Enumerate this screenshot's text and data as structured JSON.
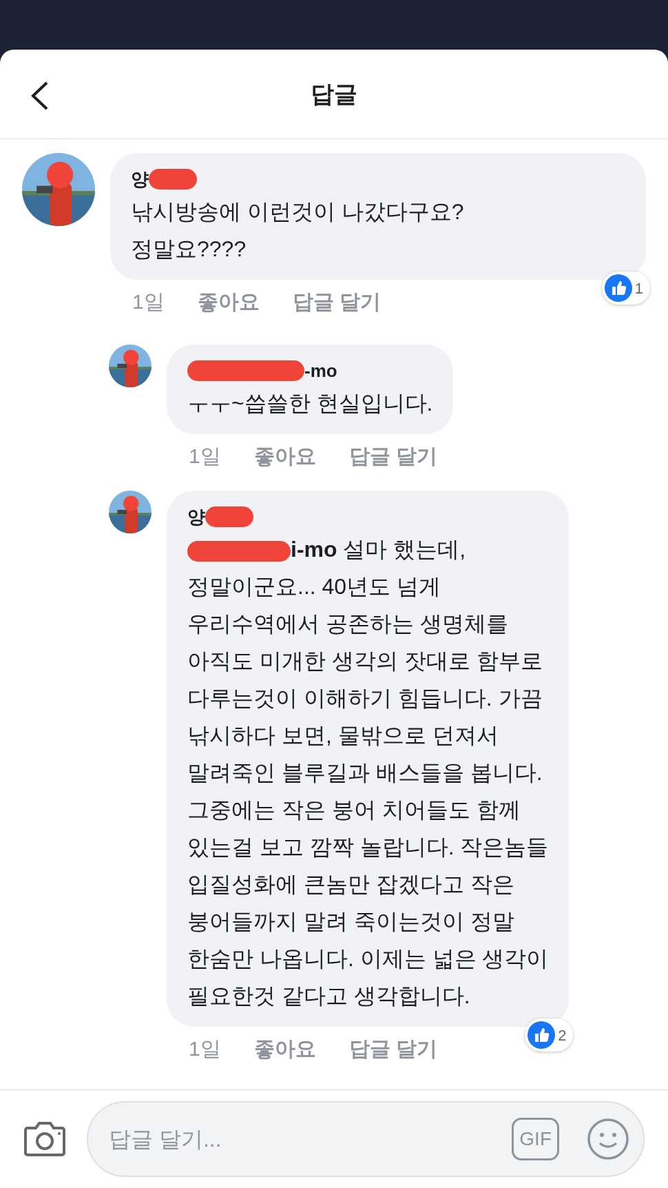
{
  "header": {
    "title": "답글"
  },
  "comments": [
    {
      "author": "양",
      "body": "낚시방송에 이런것이 나갔다구요?\n정말요????",
      "time": "1일",
      "like": "좋아요",
      "reply": "답글 달기",
      "reactions": "1",
      "children": [
        {
          "author": "-mo",
          "body": "ㅜㅜ~씁쓸한 현실입니다.",
          "time": "1일",
          "like": "좋아요",
          "reply": "답글 달기"
        },
        {
          "author": "양",
          "mention": "i-mo",
          "body": " 설마 했는데,\n정말이군요... 40년도 넘게\n우리수역에서 공존하는 생명체를\n아직도 미개한 생각의 잣대로 함부로\n다루는것이 이해하기 힘듭니다. 가끔\n낚시하다 보면, 물밖으로 던져서\n말려죽인 블루길과 배스들을 봅니다.\n그중에는 작은 붕어 치어들도 함께\n있는걸 보고 깜짝 놀랍니다. 작은놈들\n입질성화에 큰놈만 잡겠다고 작은\n붕어들까지 말려 죽이는것이 정말\n한숨만 나옵니다. 이제는 넓은 생각이\n필요한것 같다고 생각합니다.",
          "time": "1일",
          "like": "좋아요",
          "reply": "답글 달기",
          "reactions": "2"
        }
      ]
    }
  ],
  "composer": {
    "placeholder": "답글 달기...",
    "gif": "GIF"
  }
}
